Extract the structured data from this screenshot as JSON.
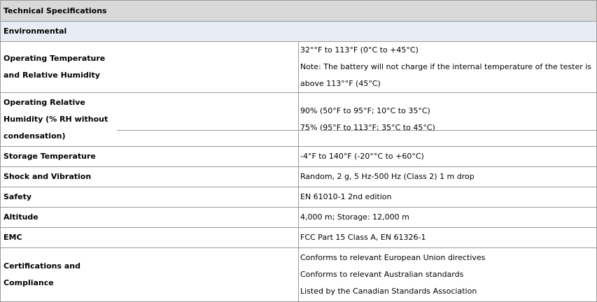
{
  "table": {
    "title": "Technical Specifications",
    "section": "Environmental",
    "rows": [
      {
        "label": [
          "Operating Temperature",
          "and Relative Humidity"
        ],
        "values": [
          "32°°F to 113°F (0°C to +45°C)",
          "Note: The battery will not charge if the internal temperature of the tester is above 113°°F (45°C)"
        ]
      },
      {
        "label": [
          "Operating Relative",
          "Humidity (% RH without",
          "condensation)"
        ],
        "values": [
          "90% (50°F to 95°F; 10°C to 35°C)",
          "75% (95°F to 113°F; 35°C to 45°C)"
        ]
      },
      {
        "label": [
          "Storage Temperature"
        ],
        "values": [
          "-4°F to 140°F (-20°°C to +60°C)"
        ]
      },
      {
        "label": [
          "Shock and Vibration"
        ],
        "values": [
          "Random, 2 g, 5 Hz-500 Hz (Class 2) 1 m drop"
        ]
      },
      {
        "label": [
          "Safety"
        ],
        "values": [
          "EN 61010-1 2nd edition"
        ]
      },
      {
        "label": [
          "Altitude"
        ],
        "values": [
          "4,000 m; Storage: 12,000 m"
        ]
      },
      {
        "label": [
          "EMC"
        ],
        "values": [
          "FCC Part 15 Class A, EN 61326-1"
        ]
      },
      {
        "label": [
          "Certifications and",
          "Compliance"
        ],
        "values": [
          "Conforms to relevant European Union directives",
          "Conforms to relevant Australian standards",
          "Listed by the Canadian Standards Association"
        ]
      }
    ]
  }
}
